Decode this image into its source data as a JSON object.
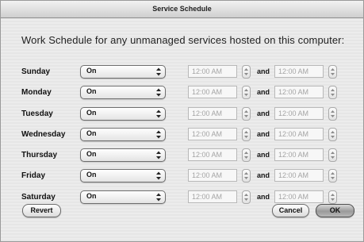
{
  "window": {
    "title": "Service Schedule"
  },
  "heading": "Work Schedule for any unmanaged services hosted on this computer:",
  "rows": [
    {
      "day": "Sunday",
      "mode": "On",
      "start": "12:00 AM",
      "conjunction": "and",
      "end": "12:00 AM"
    },
    {
      "day": "Monday",
      "mode": "On",
      "start": "12:00 AM",
      "conjunction": "and",
      "end": "12:00 AM"
    },
    {
      "day": "Tuesday",
      "mode": "On",
      "start": "12:00 AM",
      "conjunction": "and",
      "end": "12:00 AM"
    },
    {
      "day": "Wednesday",
      "mode": "On",
      "start": "12:00 AM",
      "conjunction": "and",
      "end": "12:00 AM"
    },
    {
      "day": "Thursday",
      "mode": "On",
      "start": "12:00 AM",
      "conjunction": "and",
      "end": "12:00 AM"
    },
    {
      "day": "Friday",
      "mode": "On",
      "start": "12:00 AM",
      "conjunction": "and",
      "end": "12:00 AM"
    },
    {
      "day": "Saturday",
      "mode": "On",
      "start": "12:00 AM",
      "conjunction": "and",
      "end": "12:00 AM"
    }
  ],
  "buttons": {
    "revert": "Revert",
    "cancel": "Cancel",
    "ok": "OK"
  },
  "icons": {
    "popup": "popup-arrows-icon",
    "stepper": "stepper-arrows-icon"
  }
}
